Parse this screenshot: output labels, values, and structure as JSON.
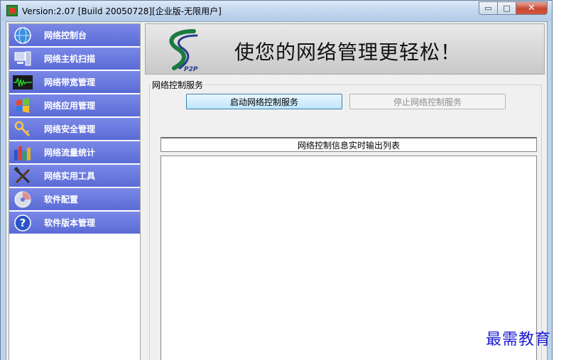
{
  "window": {
    "title": "Version:2.07 [Build 20050728][企业版-无限用户]",
    "controls": {
      "minimize": "▭",
      "maximize": "□",
      "close": "✕"
    }
  },
  "sidebar": {
    "items": [
      {
        "label": "网络控制台",
        "icon": "globe-icon",
        "glyph": "◍"
      },
      {
        "label": "网络主机扫描",
        "icon": "computer-icon",
        "glyph": "▤"
      },
      {
        "label": "网络带宽管理",
        "icon": "waveform-icon",
        "glyph": "〰"
      },
      {
        "label": "网络应用管理",
        "icon": "windows-flag-icon",
        "glyph": "◈"
      },
      {
        "label": "网络安全管理",
        "icon": "key-shield-icon",
        "glyph": "⚷"
      },
      {
        "label": "网络流量统计",
        "icon": "bar-chart-icon",
        "glyph": "▮"
      },
      {
        "label": "网络实用工具",
        "icon": "tools-icon",
        "glyph": "✕"
      },
      {
        "label": "软件配置",
        "icon": "cd-icon",
        "glyph": "◎"
      },
      {
        "label": "软件版本管理",
        "icon": "help-icon",
        "glyph": "?"
      }
    ]
  },
  "banner": {
    "slogan": "使您的网络管理更轻松！",
    "logo_text": "P2P"
  },
  "service": {
    "group_title": "网络控制服务",
    "start_label": "启动网络控制服务",
    "stop_label": "停止网络控制服务"
  },
  "output": {
    "header": "网络控制信息实时输出列表"
  },
  "watermark": "最需教育",
  "colors": {
    "nav_bg": "#6a79de",
    "accent_button": "#bee6fd",
    "watermark": "#1d1dd0"
  }
}
